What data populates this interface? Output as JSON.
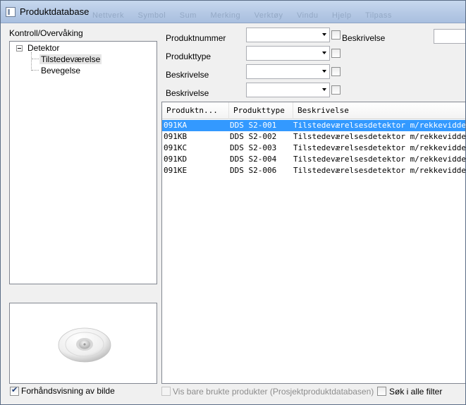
{
  "window": {
    "title": "Produktdatabase"
  },
  "ghost_menu": [
    "Nettverk",
    "Symbol",
    "Sum",
    "Merking",
    "Verktøy",
    "Vindu",
    "Hjelp",
    "Tilpass"
  ],
  "tree": {
    "label": "Kontroll/Overvåking",
    "root": "Detektor",
    "children": [
      "Tilstedeværelse",
      "Bevegelse"
    ]
  },
  "preview": {
    "checkbox_label": "Forhåndsvisning av bilde",
    "checked": true
  },
  "filters": {
    "product_number_label": "Produktnummer",
    "product_type_label": "Produkttype",
    "description_label": "Beskrivelse",
    "description2_label": "Beskrivelse",
    "search_description_label": "Beskrivelse"
  },
  "grid": {
    "columns": [
      "Produktn...",
      "Produkttype",
      "Beskrivelse"
    ],
    "rows": [
      {
        "number": "091KA",
        "type": "DDS S2-001",
        "description": "Tilstedeværelsesdetektor m/rekkevidde",
        "selected": true
      },
      {
        "number": "091KB",
        "type": "DDS S2-002",
        "description": "Tilstedeværelsesdetektor m/rekkevidde",
        "selected": false
      },
      {
        "number": "091KC",
        "type": "DDS S2-003",
        "description": "Tilstedeværelsesdetektor m/rekkevidde",
        "selected": false
      },
      {
        "number": "091KD",
        "type": "DDS S2-004",
        "description": "Tilstedeværelsesdetektor m/rekkevidde",
        "selected": false
      },
      {
        "number": "091KE",
        "type": "DDS S2-006",
        "description": "Tilstedeværelsesdetektor m/rekkevidde",
        "selected": false
      }
    ]
  },
  "footer": {
    "used_only_label": "Vis bare brukte produkter (Prosjektproduktdatabasen)",
    "search_all_label": "Søk i alle filter"
  },
  "colors": {
    "selection": "#3399ff",
    "titlebar": "#b5c9e5"
  }
}
